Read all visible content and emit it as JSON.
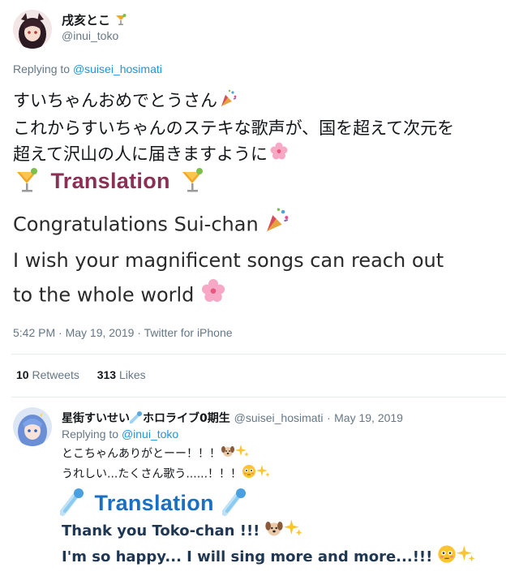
{
  "main_tweet": {
    "author_name": "戌亥とこ",
    "author_handle": "@inui_toko",
    "replying_prefix": "Replying to",
    "replying_to": "@suisei_hosimati",
    "jp_line1": "すいちゃんおめでとうさん",
    "jp_line2": "これからすいちゃんのステキな歌声が、国を超えて次元を",
    "jp_line3": "超えて沢山の人に届きますように",
    "translation_heading": "Translation",
    "en_line1": "Congratulations Sui-chan",
    "en_line2": "I wish your magnificent songs can reach out",
    "en_line3": "to the whole world",
    "timestamp": "5:42 PM · May 19, 2019 · Twitter for iPhone",
    "retweets_count": "10",
    "retweets_label": "Retweets",
    "likes_count": "313",
    "likes_label": "Likes"
  },
  "reply_tweet": {
    "author_name": "星街すいせい",
    "author_name_suffix": "ホロライブ0期生",
    "author_handle": "@suisei_hosimati",
    "dot": "·",
    "date": "May 19, 2019",
    "replying_prefix": "Replying to",
    "replying_to": "@inui_toko",
    "jp_line1": "とこちゃんありがとーー！！！",
    "jp_line2": "うれしい...たくさん歌う......！！！",
    "translation_heading": "Translation",
    "en_line1": "Thank you Toko-chan !!!",
    "en_line2": "I'm so happy... I will sing more and more...!!!"
  },
  "colors": {
    "link": "#1b95e0",
    "secondary": "#657786",
    "translation_main": "#8b2f55",
    "translation_reply": "#1a6fc2"
  }
}
